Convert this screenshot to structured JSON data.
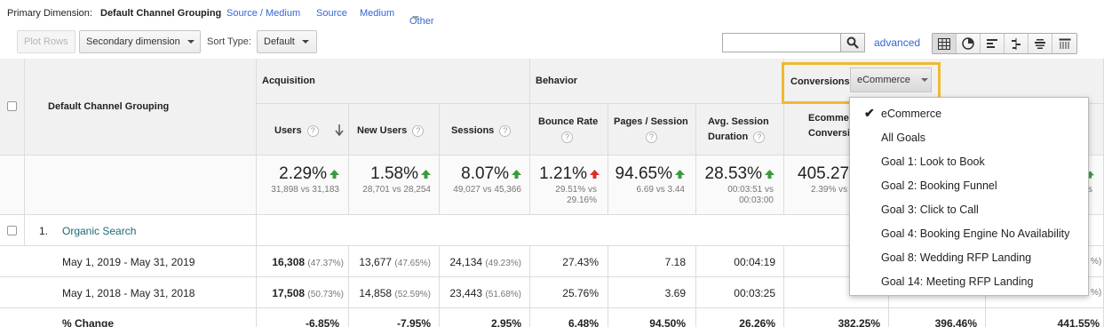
{
  "primary_dimension": {
    "label": "Primary Dimension:",
    "active": "Default Channel Grouping",
    "links": [
      "Source / Medium",
      "Source",
      "Medium",
      "Other"
    ]
  },
  "toolbar": {
    "plot_rows": "Plot Rows",
    "secondary_dimension": "Secondary dimension",
    "sort_type_label": "Sort Type:",
    "sort_type_value": "Default",
    "search_value": "",
    "advanced": "advanced"
  },
  "table": {
    "dimension_header": "Default Channel Grouping",
    "groups": {
      "acquisition": "Acquisition",
      "behavior": "Behavior",
      "conversions": "Conversions"
    },
    "conversions_select": "eCommerce",
    "columns": {
      "users": "Users",
      "new_users": "New Users",
      "sessions": "Sessions",
      "bounce_rate": "Bounce Rate",
      "pages_session": "Pages / Session",
      "avg_session_1": "Avg. Session",
      "avg_session_2": "Duration",
      "ecommerce_1": "Ecommerce",
      "ecommerce_2": "Conversion"
    },
    "help_glyph": "?",
    "summary": {
      "users": {
        "main": "2.29%",
        "sub": "31,898 vs 31,183"
      },
      "new_users": {
        "main": "1.58%",
        "sub": "28,701 vs 28,254"
      },
      "sessions": {
        "main": "8.07%",
        "sub": "49,027 vs 45,366"
      },
      "bounce_rate": {
        "main": "1.21%",
        "sub1": "29.51% vs",
        "sub2": "29.16%"
      },
      "pages_session": {
        "main": "94.65%",
        "sub": "6.69 vs 3.44"
      },
      "avg_session": {
        "main": "28.53%",
        "sub1": "00:03:51 vs",
        "sub2": "00:03:00"
      },
      "ecommerce": {
        "main": "405.27",
        "sub": "2.39% vs"
      },
      "far_right_1": "s",
      "far_right_2": "%"
    },
    "row1": {
      "index": "1.",
      "label": "Organic Search"
    },
    "row2": {
      "label": "May 1, 2019 - May 31, 2019",
      "users": "16,308",
      "users_pct": "(47.37%)",
      "new_users": "13,677",
      "new_users_pct": "(47.65%)",
      "sessions": "24,134",
      "sessions_pct": "(49.23%)",
      "bounce_rate": "27.43%",
      "pages_session": "7.18",
      "avg_session": "00:04:19",
      "far_right": "%)"
    },
    "row3": {
      "label": "May 1, 2018 - May 31, 2018",
      "users": "17,508",
      "users_pct": "(50.73%)",
      "new_users": "14,858",
      "new_users_pct": "(52.59%)",
      "sessions": "23,443",
      "sessions_pct": "(51.68%)",
      "bounce_rate": "25.76%",
      "pages_session": "3.69",
      "avg_session": "00:03:25",
      "far_right": "%)"
    },
    "row4": {
      "label": "% Change",
      "users": "-6.85%",
      "new_users": "-7.95%",
      "sessions": "2.95%",
      "bounce_rate": "6.48%",
      "pages_session": "94.50%",
      "avg_session": "26.26%",
      "ecommerce": "382.25%",
      "c8": "396.46%",
      "c9": "441.55%"
    }
  },
  "dropdown": {
    "items": [
      "eCommerce",
      "All Goals",
      "Goal 1: Look to Book",
      "Goal 2: Booking Funnel",
      "Goal 3: Click to Call",
      "Goal 4: Booking Engine No Availability",
      "Goal 8: Wedding RFP Landing",
      "Goal 14: Meeting RFP Landing"
    ],
    "checkmark": "✔"
  },
  "colors": {
    "link": "#3367d6",
    "up": "#3c9a3c",
    "down": "#d93025",
    "highlight": "#f1b930"
  }
}
